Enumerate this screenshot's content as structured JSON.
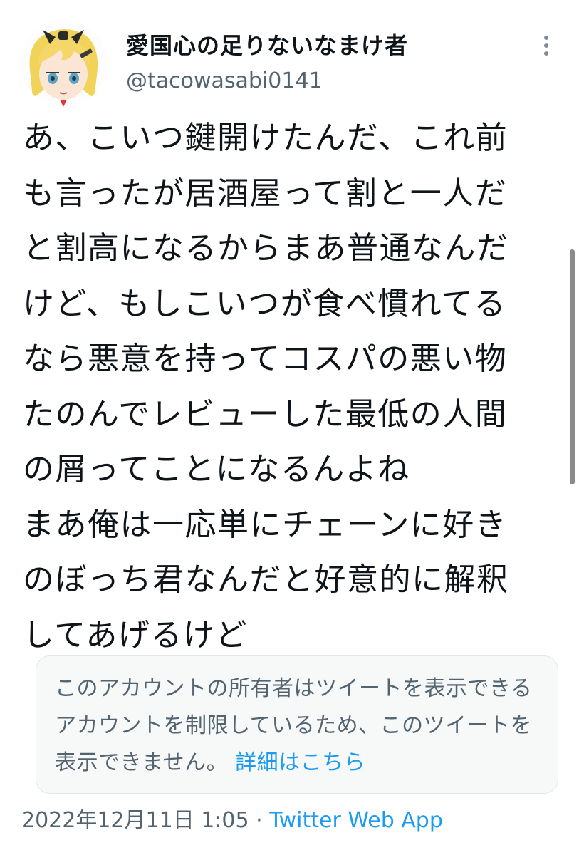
{
  "tweet": {
    "author": {
      "display_name": "愛国心の足りないなまけ者",
      "handle": "@tacowasabi0141",
      "avatar_icon": "anime-avatar-icon"
    },
    "more_icon": "more-vertical-icon",
    "text": "あ、こいつ鍵開けたんだ、これ前\nも言ったが居酒屋って割と一人だ\nと割高になるからまあ普通なんだ\nけど、もしこいつが食べ慣れてる\nなら悪意を持ってコスパの悪い物\nたのんでレビューした最低の人間\nの屑ってことになるんよね\nまあ俺は一応単にチェーンに好き\nのぼっち君なんだと好意的に解釈\nしてあげるけど",
    "withheld_notice": {
      "message": "このアカウントの所有者はツイートを表示できるアカウントを制限しているため、このツイートを表示できません。",
      "link_label": "詳細はこちら"
    },
    "timestamp": "2022年12月11日 1:05",
    "separator": "·",
    "source": "Twitter Web App"
  },
  "colors": {
    "text_primary": "#0f1419",
    "text_secondary": "#536471",
    "link": "#1d9bf0",
    "notice_background": "#f7f9f9"
  }
}
